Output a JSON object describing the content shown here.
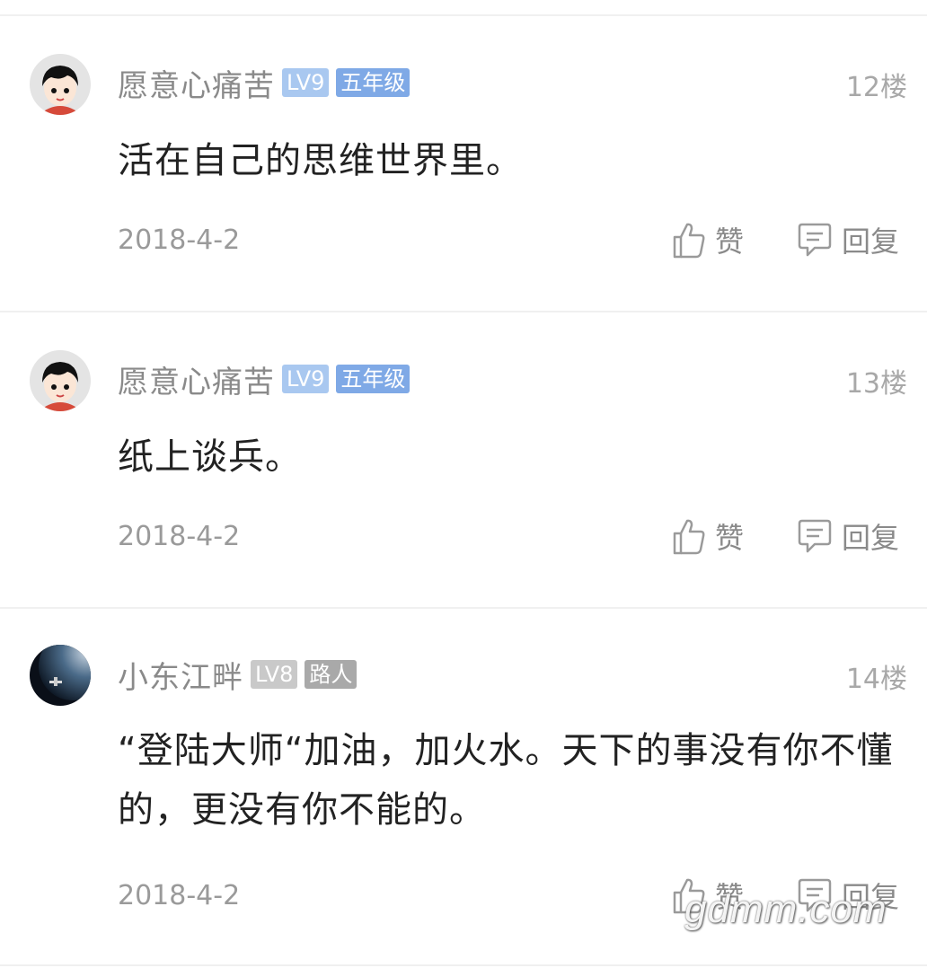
{
  "comments": [
    {
      "username": "愿意心痛苦",
      "level": "LV9",
      "rank": "五年级",
      "floor": "12楼",
      "content": "活在自己的思维世界里。",
      "date": "2018-4-2",
      "like_label": "赞",
      "reply_label": "回复",
      "avatar_icon": "cartoon-avatar-icon"
    },
    {
      "username": "愿意心痛苦",
      "level": "LV9",
      "rank": "五年级",
      "floor": "13楼",
      "content": "纸上谈兵。",
      "date": "2018-4-2",
      "like_label": "赞",
      "reply_label": "回复",
      "avatar_icon": "cartoon-avatar-icon"
    },
    {
      "username": "小东江畔",
      "level": "LV8",
      "rank": "路人",
      "floor": "14楼",
      "content": "“登陆大师“加油，加火水。天下的事没有你不懂的，更没有你不能的。",
      "date": "2018-4-2",
      "like_label": "赞",
      "reply_label": "回复",
      "avatar_icon": "space-photo-avatar-icon"
    }
  ],
  "watermark": "gdmm.com",
  "colors": {
    "level_badge_blue": "#a9c8f0",
    "rank_badge_blue": "#7fa9e6",
    "level_badge_gray": "#c9c9c9",
    "rank_badge_gray": "#a9a9a9",
    "username": "#8a8a8a",
    "content": "#222222",
    "meta": "#9a9a9a"
  }
}
